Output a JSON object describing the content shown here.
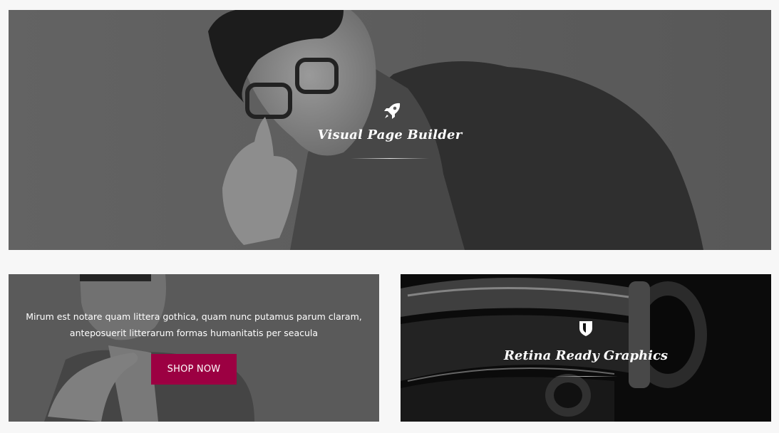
{
  "hero": {
    "title": "Visual Page Builder",
    "icon": "rocket-icon"
  },
  "promo": {
    "text_line1": "Mirum est notare quam littera gothica, quam nunc putamus parum claram,",
    "text_line2": "anteposuerit litterarum formas humanitatis per seacula",
    "button_label": "SHOP NOW",
    "button_color": "#9c0042"
  },
  "retina": {
    "title": "Retina Ready Graphics",
    "icon": "shield-icon"
  }
}
